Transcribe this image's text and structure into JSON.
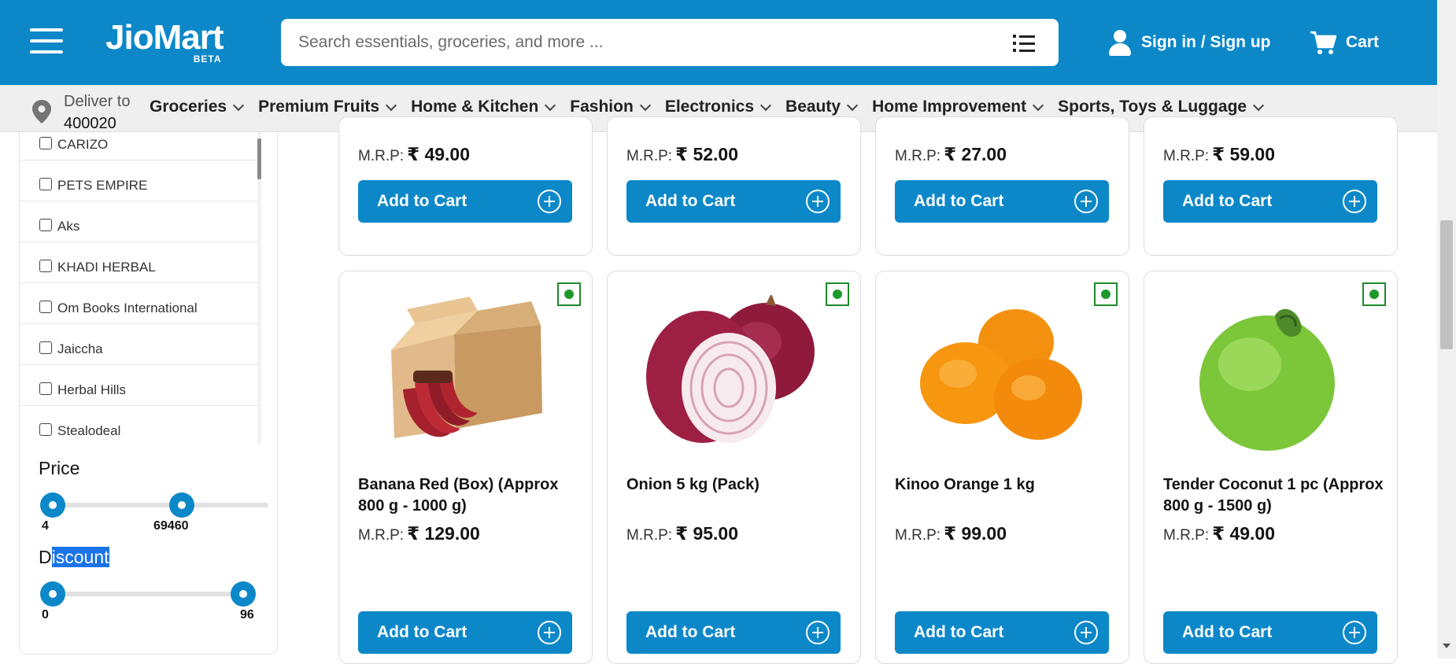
{
  "header": {
    "logo": "JioMart",
    "logo_badge": "BETA",
    "search_placeholder": "Search essentials, groceries, and more ...",
    "signin_label": "Sign in / Sign up",
    "cart_label": "Cart"
  },
  "delivery": {
    "label": "Deliver to",
    "pincode": "400020"
  },
  "categories": [
    "Groceries",
    "Premium Fruits",
    "Home & Kitchen",
    "Fashion",
    "Electronics",
    "Beauty",
    "Home Improvement",
    "Sports, Toys & Luggage"
  ],
  "brands": [
    "CARIZO",
    "PETS EMPIRE",
    "Aks",
    "KHADI HERBAL",
    "Om Books International",
    "Jaiccha",
    "Herbal Hills",
    "Stealodeal"
  ],
  "price_filter": {
    "title": "Price",
    "min": "4",
    "max": "69460"
  },
  "discount_filter": {
    "title_first": "D",
    "title_rest": "iscount",
    "min": "0",
    "max": "96"
  },
  "mrp_label": "M.R.P:",
  "add_to_cart": "Add to Cart",
  "top_row_prices": [
    "₹ 49.00",
    "₹ 52.00",
    "₹ 27.00",
    "₹ 59.00"
  ],
  "products": [
    {
      "name": "Banana Red (Box) (Approx 800 g - 1000 g)",
      "price": "₹ 129.00",
      "image": "red-banana-box"
    },
    {
      "name": "Onion 5 kg (Pack)",
      "price": "₹ 95.00",
      "image": "onion"
    },
    {
      "name": "Kinoo Orange 1 kg",
      "price": "₹ 99.00",
      "image": "orange"
    },
    {
      "name": "Tender Coconut 1 pc (Approx 800 g - 1500 g)",
      "price": "₹ 49.00",
      "image": "coconut"
    }
  ],
  "colors": {
    "brand_blue": "#0c88c9",
    "veg_green": "#1e9a2d"
  }
}
